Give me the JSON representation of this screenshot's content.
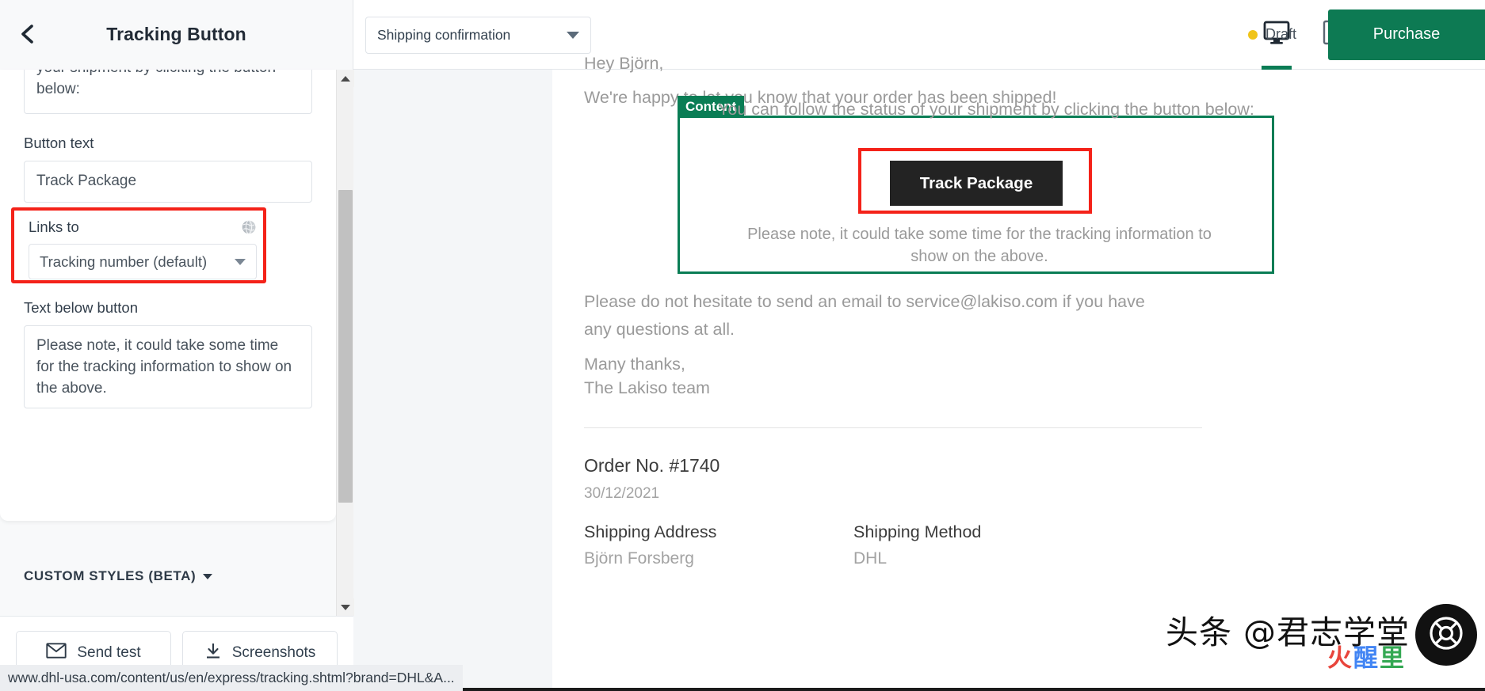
{
  "topbar": {
    "panel_title": "Tracking Button",
    "back_icon": "chevron-left-icon",
    "template_select_value": "Shipping confirmation",
    "devices": [
      {
        "name": "desktop-icon",
        "active": true
      },
      {
        "name": "mobile-icon",
        "active": false
      }
    ],
    "status_label": "Draft",
    "status_color": "#f0c419",
    "purchase_label": "Purchase",
    "purchase_color": "#0d7a53"
  },
  "sidebar": {
    "body_text_clipped": "your shipment by clicking the button below:",
    "button_text": {
      "label": "Button text",
      "value": "Track Package"
    },
    "links_to": {
      "label": "Links to",
      "icon": "globe-icon",
      "value": "Tracking number (default)",
      "highlight_color": "#f42219"
    },
    "text_below_button": {
      "label": "Text below button",
      "value": "Please note, it could take some time for the tracking information to show on the above."
    },
    "custom_styles_label": "CUSTOM STYLES (BETA)",
    "footer": {
      "send_test_label": "Send test",
      "send_test_icon": "envelope-icon",
      "screenshots_label": "Screenshots",
      "screenshots_icon": "download-icon"
    }
  },
  "preview": {
    "greeting": "Hey Björn,",
    "intro": "We're happy to let you know that your order has been shipped!",
    "content_badge": "Content",
    "content_badge_color": "#0a7d55",
    "content_line": "You can follow the status of your shipment by clicking the button below:",
    "track_button_label": "Track Package",
    "track_button_bg": "#232323",
    "button_subtext_line1": "Please note, it could take some time for the tracking information to",
    "button_subtext_line2": "show on the above.",
    "support_line1": "Please do not hesitate to send an email to service@lakiso.com if you have",
    "support_line2": "any questions at all.",
    "thanks_line1": "Many thanks,",
    "thanks_line2": "The Lakiso team",
    "order_no": "Order No. #1740",
    "order_date": "30/12/2021",
    "shipping_address_head": "Shipping Address",
    "shipping_address_val": "Björn Forsberg",
    "shipping_method_head": "Shipping Method",
    "shipping_method_val": "DHL",
    "help_icon": "lifebuoy-icon"
  },
  "status_bar": {
    "url": "www.dhl-usa.com/content/us/en/express/tracking.shtml?brand=DHL&A..."
  },
  "watermark": {
    "line1": "头条 @君志学堂",
    "line2_red": "火",
    "line2_blue": "醒",
    "line2_green": "里"
  }
}
